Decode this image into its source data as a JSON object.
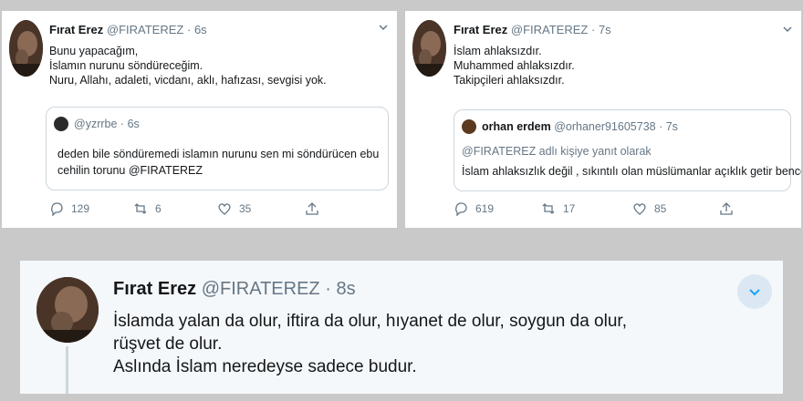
{
  "tweet1": {
    "name": "Fırat Erez",
    "handle": "@FIRATEREZ",
    "sep": "·",
    "time": "6s",
    "lines": [
      "Bunu yapacağım,",
      "İslamın nurunu söndüreceğim.",
      "Nuru, Allahı, adaleti, vicdanı, aklı, hafızası, sevgisi yok."
    ],
    "quote": {
      "handle": "@yzrrbe",
      "sep": "·",
      "time": "6s",
      "lines": [
        "deden bile söndüremedi islamın nurunu sen mi söndürücen ebu",
        "cehilin torunu @FIRATEREZ"
      ]
    },
    "counts": {
      "replies": "129",
      "retweets": "6",
      "likes": "35"
    }
  },
  "tweet2": {
    "name": "Fırat Erez",
    "handle": "@FIRATEREZ",
    "sep": "·",
    "time": "7s",
    "lines": [
      "İslam ahlaksızdır.",
      "Muhammed ahlaksızdır.",
      "Takipçileri ahlaksızdır."
    ],
    "quote": {
      "name": "orhan erdem",
      "handle": "@orhaner91605738",
      "sep": "·",
      "time": "7s",
      "reply": "@FIRATEREZ adlı kişiye yanıt olarak",
      "text": "İslam ahlaksızlık değil , sıkıntılı olan müslümanlar açıklık getir bence"
    },
    "counts": {
      "replies": "619",
      "retweets": "17",
      "likes": "85"
    }
  },
  "tweet3": {
    "name": "Fırat Erez",
    "handle": "@FIRATEREZ",
    "sep": "·",
    "time": "8s",
    "lines": [
      "İslamda yalan da olur, iftira da olur, hıyanet de olur, soygun da olur,",
      "rüşvet de olur.",
      "Aslında İslam neredeyse sadece budur."
    ]
  },
  "icons": {
    "more": "chevron-down-icon",
    "reply": "reply-icon",
    "retweet": "retweet-icon",
    "like": "heart-icon",
    "share": "share-icon"
  },
  "colors": {
    "accent": "#1da1f2",
    "muted": "#657786",
    "border": "#ccd6dd",
    "chevron_bg": "#dbe8f3"
  }
}
